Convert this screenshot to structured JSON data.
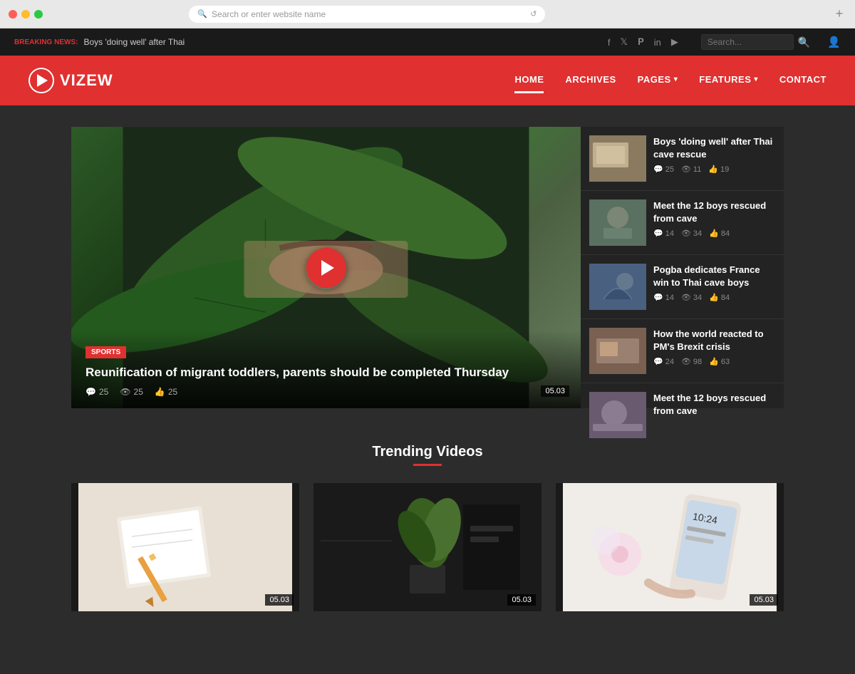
{
  "browser": {
    "address_placeholder": "Search or enter website name",
    "add_tab_label": "+"
  },
  "topbar": {
    "breaking_news_label": "BREAKING NEWS:",
    "breaking_news_text": "Boys 'doing well' after Thai",
    "social_icons": [
      "f",
      "t",
      "p",
      "in",
      "▶"
    ],
    "search_placeholder": "Search...",
    "search_icon": "🔍",
    "user_icon": "👤"
  },
  "header": {
    "logo_text": "VIZEW",
    "nav_items": [
      {
        "label": "HOME",
        "active": true,
        "has_dropdown": false
      },
      {
        "label": "ARCHIVES",
        "active": false,
        "has_dropdown": false
      },
      {
        "label": "PAGES",
        "active": false,
        "has_dropdown": true
      },
      {
        "label": "FEATURES",
        "active": false,
        "has_dropdown": true
      },
      {
        "label": "CONTACT",
        "active": false,
        "has_dropdown": false
      }
    ]
  },
  "featured": {
    "category": "SPORTS",
    "title": "Reunification of migrant toddlers, parents should be completed Thursday",
    "meta_comments": "25",
    "meta_views": "25",
    "meta_likes": "25",
    "timestamp": "05.03"
  },
  "sidebar_articles": [
    {
      "title": "Boys 'doing well' after Thai cave rescue",
      "comments": "25",
      "views": "11",
      "likes": "19"
    },
    {
      "title": "Meet the 12 boys rescued from cave",
      "comments": "14",
      "views": "34",
      "likes": "84"
    },
    {
      "title": "Pogba dedicates France win to Thai cave boys",
      "comments": "14",
      "views": "34",
      "likes": "84"
    },
    {
      "title": "How the world reacted to PM's Brexit crisis",
      "comments": "24",
      "views": "98",
      "likes": "63"
    },
    {
      "title": "Meet the 12 boys rescued from cave",
      "comments": "",
      "views": "",
      "likes": ""
    }
  ],
  "trending": {
    "section_title": "Trending Videos",
    "cards": [
      {
        "timestamp": "05.03",
        "thumb_class": "thumb-journal"
      },
      {
        "timestamp": "05.03",
        "thumb_class": "thumb-plant"
      },
      {
        "timestamp": "05.03",
        "thumb_class": "thumb-phone"
      }
    ]
  }
}
